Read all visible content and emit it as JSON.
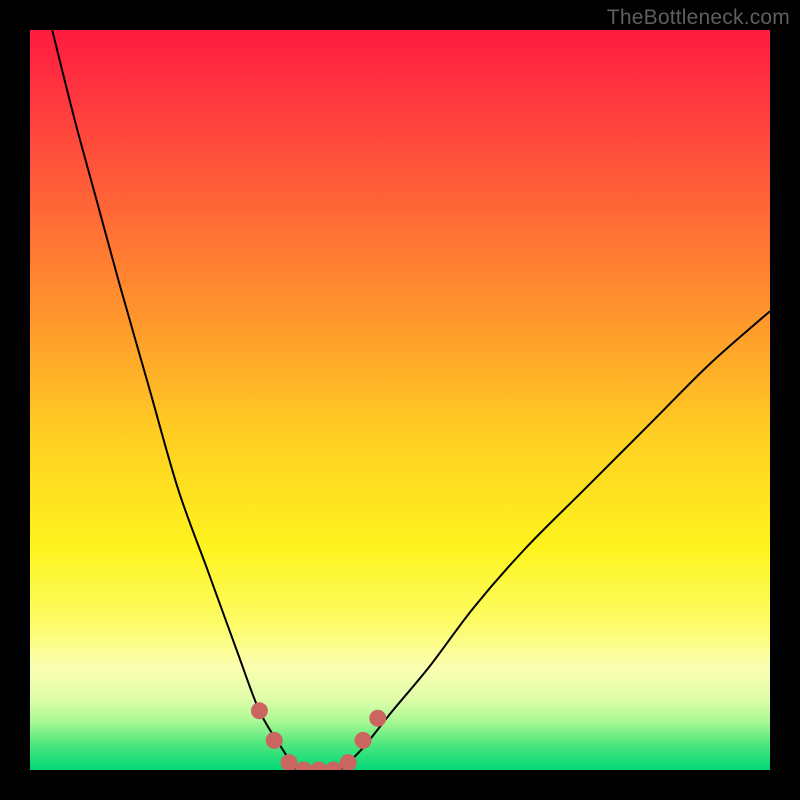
{
  "watermark": "TheBottleneck.com",
  "colors": {
    "black": "#000000",
    "curve": "#000000",
    "marker": "#cb6560",
    "gradient_stops": [
      {
        "offset": 0.0,
        "color": "#ff1b3f"
      },
      {
        "offset": 0.1,
        "color": "#ff3a3f"
      },
      {
        "offset": 0.25,
        "color": "#ff6a36"
      },
      {
        "offset": 0.4,
        "color": "#ff9a2c"
      },
      {
        "offset": 0.55,
        "color": "#ffcf22"
      },
      {
        "offset": 0.7,
        "color": "#fdf41e"
      },
      {
        "offset": 0.8,
        "color": "#fdfc65"
      },
      {
        "offset": 0.86,
        "color": "#fbfeb0"
      },
      {
        "offset": 0.905,
        "color": "#dffda9"
      },
      {
        "offset": 0.935,
        "color": "#a7f893"
      },
      {
        "offset": 0.965,
        "color": "#4fe67d"
      },
      {
        "offset": 1.0,
        "color": "#00d877"
      }
    ]
  },
  "chart_data": {
    "type": "line",
    "title": "",
    "xlabel": "",
    "ylabel": "",
    "xlim": [
      0,
      100
    ],
    "ylim": [
      0,
      100
    ],
    "note": "Axes are hidden; values are estimated from pixel positions. y is the bottleneck percentage (0 = no bottleneck / green, 100 = severe / red).",
    "series": [
      {
        "name": "left-curve",
        "x": [
          3,
          6,
          9,
          12,
          16,
          20,
          24,
          28,
          31,
          34,
          36
        ],
        "y": [
          100,
          88,
          77,
          66,
          52,
          38,
          27,
          16,
          8,
          3,
          0
        ]
      },
      {
        "name": "right-curve",
        "x": [
          42,
          45,
          49,
          54,
          60,
          67,
          75,
          84,
          92,
          100
        ],
        "y": [
          0,
          3,
          8,
          14,
          22,
          30,
          38,
          47,
          55,
          62
        ]
      }
    ],
    "flat_region": {
      "x_start": 36,
      "x_end": 42,
      "y": 0
    },
    "markers": {
      "name": "highlighted-range",
      "points": [
        {
          "x": 31,
          "y": 8
        },
        {
          "x": 33,
          "y": 4
        },
        {
          "x": 35,
          "y": 1
        },
        {
          "x": 37,
          "y": 0
        },
        {
          "x": 39,
          "y": 0
        },
        {
          "x": 41,
          "y": 0
        },
        {
          "x": 43,
          "y": 1
        },
        {
          "x": 45,
          "y": 4
        },
        {
          "x": 47,
          "y": 7
        }
      ]
    }
  }
}
